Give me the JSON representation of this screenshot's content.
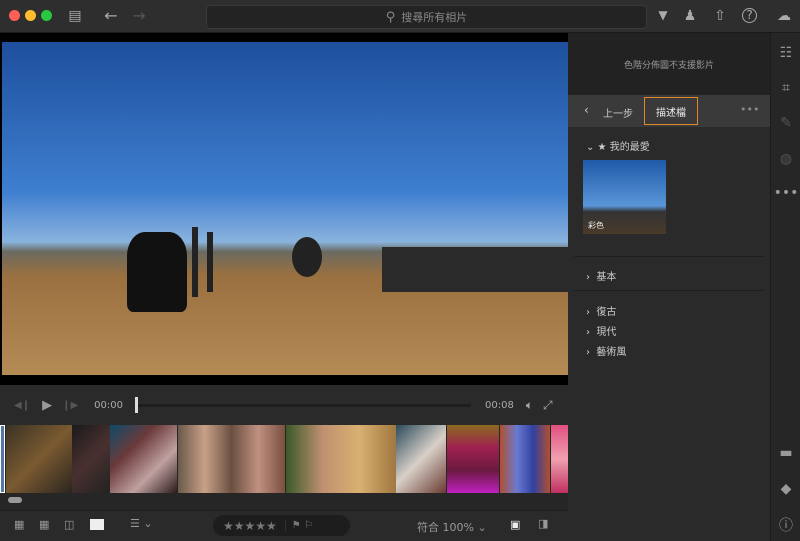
{
  "titlebar": {
    "search_placeholder": "搜尋所有相片"
  },
  "player": {
    "current_time": "00:00",
    "duration": "00:08",
    "progress": 0
  },
  "panel": {
    "histogram_message": "色階分佈圖不支援影片",
    "back_label": "上一步",
    "active_tab": "描述檔",
    "favorites_label": "我的最愛",
    "favorite_preset": "彩色",
    "groups": [
      "基本",
      "復古",
      "現代",
      "藝術風"
    ]
  },
  "bottombar": {
    "fit_label": "符合",
    "zoom": "100%",
    "rating": 0
  },
  "colors": {
    "accent": "#e0892b",
    "close": "#fe5f57",
    "min": "#febc2e",
    "max": "#28c840"
  }
}
